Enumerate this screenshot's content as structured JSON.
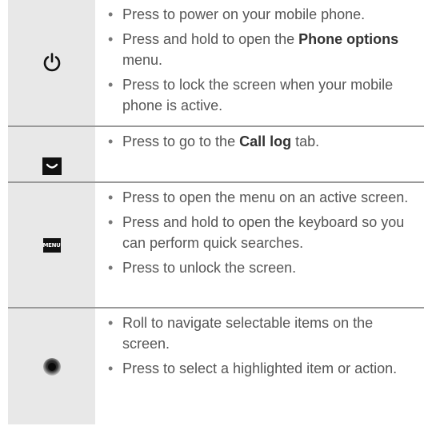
{
  "rows": [
    {
      "icon": "power-icon",
      "bullets": [
        {
          "segments": [
            {
              "t": "Press to power on your mobile phone.",
              "b": false
            }
          ]
        },
        {
          "segments": [
            {
              "t": "Press and hold to open the ",
              "b": false
            },
            {
              "t": "Phone options",
              "b": true
            },
            {
              "t": " menu.",
              "b": false
            }
          ]
        },
        {
          "segments": [
            {
              "t": "Press to lock the screen when your mobile phone is active.",
              "b": false
            }
          ]
        }
      ]
    },
    {
      "icon": "call-log-key-icon",
      "bullets": [
        {
          "segments": [
            {
              "t": "Press to go to the ",
              "b": false
            },
            {
              "t": "Call log",
              "b": true
            },
            {
              "t": " tab.",
              "b": false
            }
          ]
        }
      ]
    },
    {
      "icon": "menu-key-icon",
      "icon_label": "MENU",
      "bullets": [
        {
          "segments": [
            {
              "t": "Press to open the menu on an active screen.",
              "b": false
            }
          ]
        },
        {
          "segments": [
            {
              "t": "Press and hold to open the keyboard so you can perform quick searches.",
              "b": false
            }
          ]
        },
        {
          "segments": [
            {
              "t": "Press to unlock the screen.",
              "b": false
            }
          ]
        }
      ]
    },
    {
      "icon": "trackball-icon",
      "bullets": [
        {
          "segments": [
            {
              "t": "Roll to navigate selectable items on the screen.",
              "b": false
            }
          ]
        },
        {
          "segments": [
            {
              "t": "Press to select a highlighted item or action.",
              "b": false
            }
          ]
        }
      ]
    }
  ]
}
